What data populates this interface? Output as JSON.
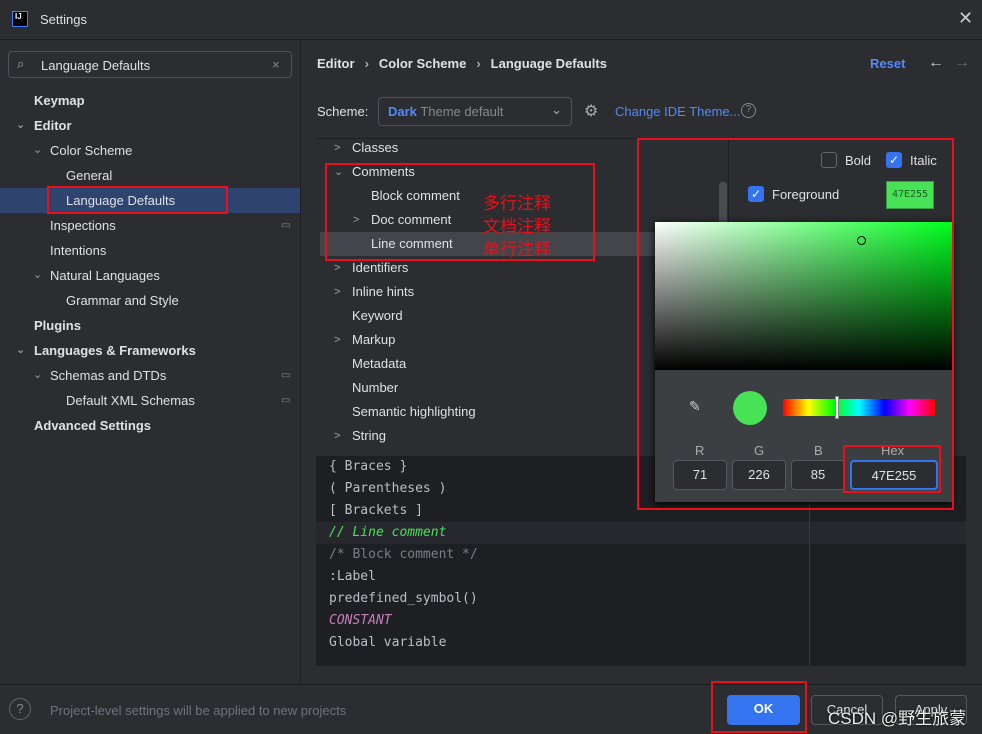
{
  "window": {
    "title": "Settings",
    "logo": "IJ"
  },
  "search": {
    "value": "Language Defaults"
  },
  "sidebar": {
    "items": [
      {
        "label": "Keymap"
      },
      {
        "label": "Editor"
      },
      {
        "label": "Color Scheme"
      },
      {
        "label": "General"
      },
      {
        "label": "Language Defaults"
      },
      {
        "label": "Inspections"
      },
      {
        "label": "Intentions"
      },
      {
        "label": "Natural Languages"
      },
      {
        "label": "Grammar and Style"
      },
      {
        "label": "Plugins"
      },
      {
        "label": "Languages & Frameworks"
      },
      {
        "label": "Schemas and DTDs"
      },
      {
        "label": "Default XML Schemas"
      },
      {
        "label": "Advanced Settings"
      }
    ]
  },
  "breadcrumb": [
    "Editor",
    "Color Scheme",
    "Language Defaults"
  ],
  "header": {
    "reset": "Reset"
  },
  "scheme": {
    "label": "Scheme:",
    "value_bold": "Dark",
    "value_rest": "Theme default",
    "change_theme": "Change IDE Theme..."
  },
  "tree": [
    {
      "label": "Classes"
    },
    {
      "label": "Comments"
    },
    {
      "label": "Block comment"
    },
    {
      "label": "Doc comment"
    },
    {
      "label": "Line comment"
    },
    {
      "label": "Identifiers"
    },
    {
      "label": "Inline hints"
    },
    {
      "label": "Keyword"
    },
    {
      "label": "Markup"
    },
    {
      "label": "Metadata"
    },
    {
      "label": "Number"
    },
    {
      "label": "Semantic highlighting"
    },
    {
      "label": "String"
    }
  ],
  "annotations": [
    "多行注释",
    "文档注释",
    "单行注释"
  ],
  "options": {
    "bold": "Bold",
    "italic": "Italic",
    "foreground": "Foreground",
    "swatch": "47E255",
    "bold_checked": false,
    "italic_checked": true,
    "foreground_checked": true
  },
  "picker": {
    "r_label": "R",
    "g_label": "G",
    "b_label": "B",
    "hex_label": "Hex",
    "r": "71",
    "g": "226",
    "b": "85",
    "hex": "47E255",
    "color": "#47e255"
  },
  "preview": [
    "{ Braces }",
    "( Parentheses )",
    "[ Brackets ]",
    "// Line comment",
    "/* Block comment */",
    ":Label",
    "predefined_symbol()",
    "CONSTANT",
    "Global variable"
  ],
  "footer": {
    "hint": "Project-level settings will be applied to new projects",
    "ok": "OK",
    "cancel": "Cancel",
    "apply": "Apply",
    "watermark": "CSDN @野生旅蒙"
  }
}
